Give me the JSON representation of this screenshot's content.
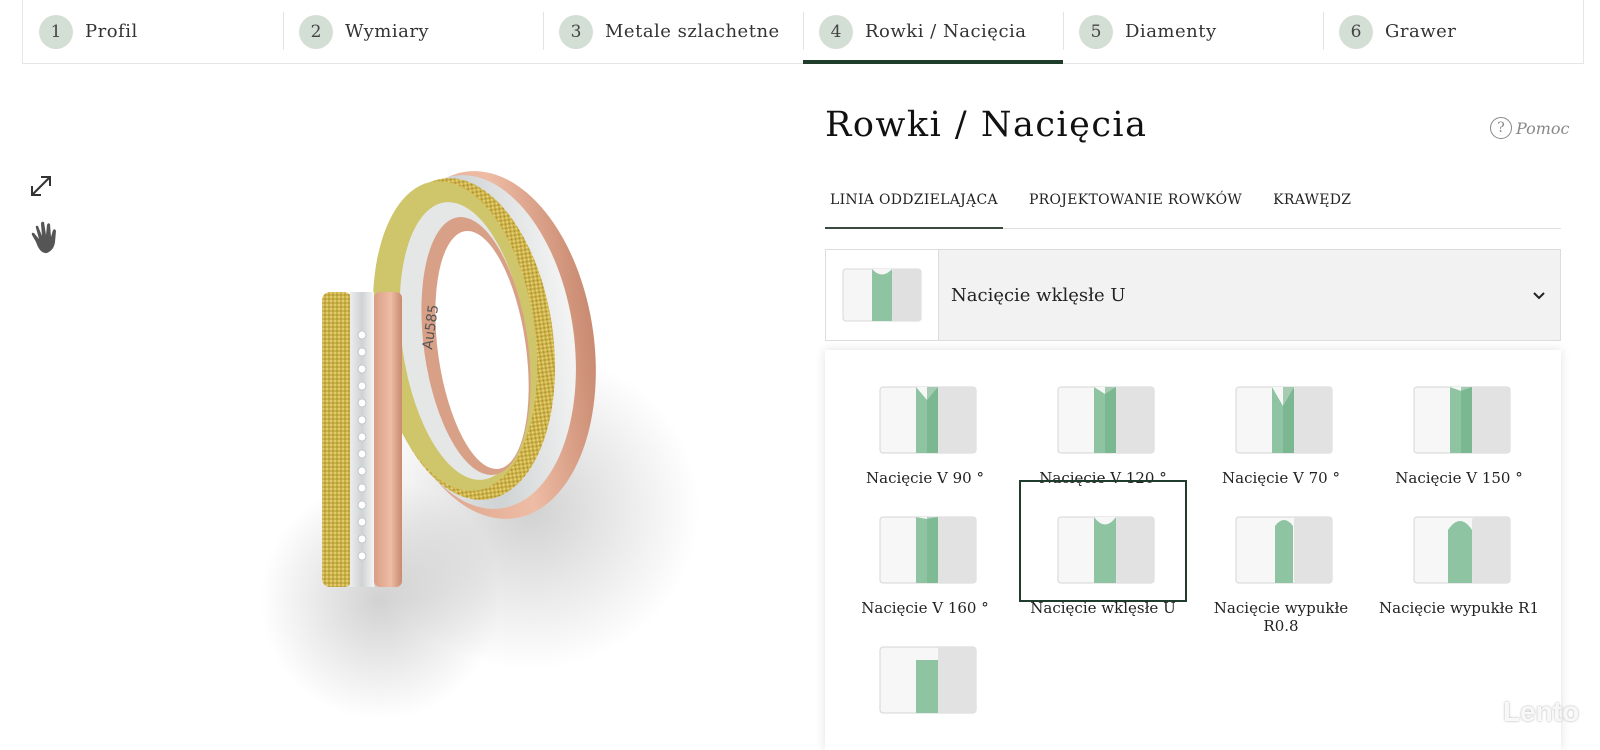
{
  "steps": [
    {
      "num": "1",
      "label": "Profil"
    },
    {
      "num": "2",
      "label": "Wymiary"
    },
    {
      "num": "3",
      "label": "Metale szlachetne"
    },
    {
      "num": "4",
      "label": "Rowki / Nacięcia"
    },
    {
      "num": "5",
      "label": "Diamenty"
    },
    {
      "num": "6",
      "label": "Grawer"
    }
  ],
  "active_step": 4,
  "viewer": {
    "tools": [
      "expand-icon",
      "hand-icon"
    ],
    "ring_engraving": "Au585"
  },
  "panel": {
    "title": "Rowki / Nacięcia",
    "help_label": "Pomoc",
    "subtabs": [
      "LINIA ODDZIELAJĄCA",
      "PROJEKTOWANIE ROWKÓW",
      "KRAWĘDZ"
    ],
    "active_subtab": "LINIA ODDZIELAJĄCA",
    "select": {
      "value": "Nacięcie wklęsłe U"
    },
    "options": [
      "Nacięcie V 90 °",
      "Nacięcie V 120 °",
      "Nacięcie V 70 °",
      "Nacięcie V 150 °",
      "Nacięcie V 160 °",
      "Nacięcie wklęsłe U",
      "Nacięcie wypukłe R0.8",
      "Nacięcie wypukłe R1",
      ""
    ],
    "selected_option": "Nacięcie wklęsłe U"
  },
  "colors": {
    "accent": "#1f3d2a",
    "groove": "#8fc4a2",
    "step_circle": "#d3ded5"
  },
  "watermark": "Lento"
}
